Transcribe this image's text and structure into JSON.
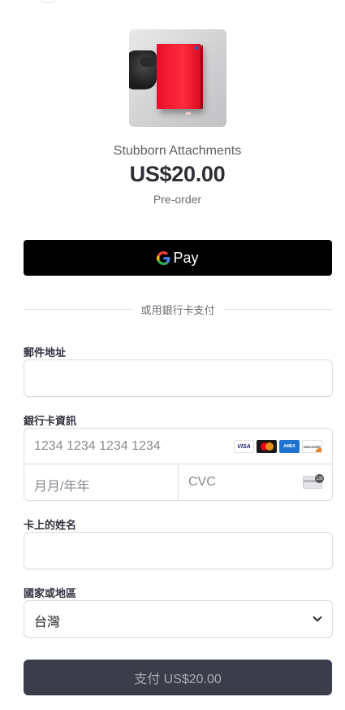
{
  "product": {
    "name": "Stubborn Attachments",
    "price": "US$20.00",
    "status": "Pre-order"
  },
  "wallet": {
    "label": "Pay",
    "icon": "google-g-icon"
  },
  "divider_text": "或用銀行卡支付",
  "form": {
    "email": {
      "label": "郵件地址",
      "value": ""
    },
    "card": {
      "label": "銀行卡資訊",
      "number_placeholder": "1234 1234 1234 1234",
      "expiry_placeholder": "月月/年年",
      "cvc_placeholder": "CVC",
      "brands": [
        "VISA",
        "mastercard",
        "AMEX",
        "DISCOVER"
      ]
    },
    "name": {
      "label": "卡上的姓名",
      "value": ""
    },
    "country": {
      "label": "國家或地區",
      "selected": "台灣"
    }
  },
  "submit": {
    "label": "支付 US$20.00"
  },
  "colors": {
    "wallet_bg": "#000000",
    "pay_bg": "#3b3e4a",
    "pay_text": "#a9abb3",
    "border": "#dcdce0"
  }
}
